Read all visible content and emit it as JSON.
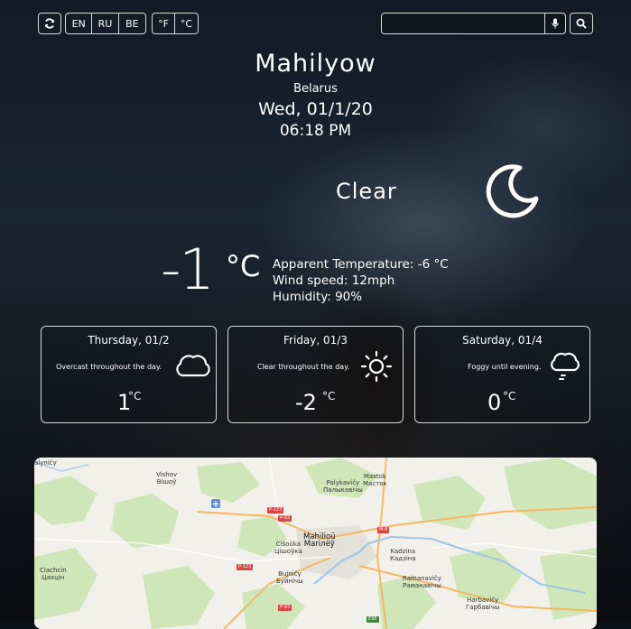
{
  "controls": {
    "refresh_icon": "refresh-icon",
    "languages": [
      "EN",
      "RU",
      "BE"
    ],
    "units": [
      "°F",
      "°C"
    ],
    "search_placeholder": "",
    "mic_icon": "microphone-icon",
    "search_icon": "search-icon"
  },
  "location": {
    "city": "Mahilyow",
    "country": "Belarus",
    "date": "Wed, 01/1/20",
    "time": "06:18 PM"
  },
  "current": {
    "summary": "Clear",
    "icon": "moon-icon",
    "temperature": "-1",
    "unit": "°C",
    "apparent": "Apparent Temperature: -6 °C",
    "wind": "Wind speed: 12mph",
    "humidity": "Humidity: 90%"
  },
  "forecast": [
    {
      "day": "Thursday, 01/2",
      "desc": "Overcast throughout the day.",
      "icon": "cloud-icon",
      "temp": "1",
      "unit": "°C"
    },
    {
      "day": "Friday, 01/3",
      "desc": "Clear throughout the day.",
      "icon": "sun-icon",
      "temp": "-2",
      "unit": "°C"
    },
    {
      "day": "Saturday, 01/4",
      "desc": "Foggy until evening.",
      "icon": "fog-icon",
      "temp": "0",
      "unit": "°C"
    }
  ],
  "map": {
    "labels": [
      {
        "text": "alyničy",
        "sub": ""
      },
      {
        "text": "Vishov",
        "sub": "Вішоў"
      },
      {
        "text": "Palykavičy",
        "sub": "Палыкавічы"
      },
      {
        "text": "Mastok",
        "sub": "Масток"
      },
      {
        "text": "Mahilioŭ",
        "sub": "Mariлёў"
      },
      {
        "text": "Cišoŭka",
        "sub": "Цішоўка"
      },
      {
        "text": "Kadzina",
        "sub": "Кадзіна"
      },
      {
        "text": "Ciachcin",
        "sub": "Цяхцін"
      },
      {
        "text": "Bujničy",
        "sub": "Буйнічы"
      },
      {
        "text": "Ramanavičy",
        "sub": "Раманавічы"
      },
      {
        "text": "Harbavičy",
        "sub": "Гарбавічы"
      }
    ],
    "roads": [
      "P-123",
      "P-123",
      "P-93",
      "M-8",
      "P-93",
      "E95"
    ]
  }
}
